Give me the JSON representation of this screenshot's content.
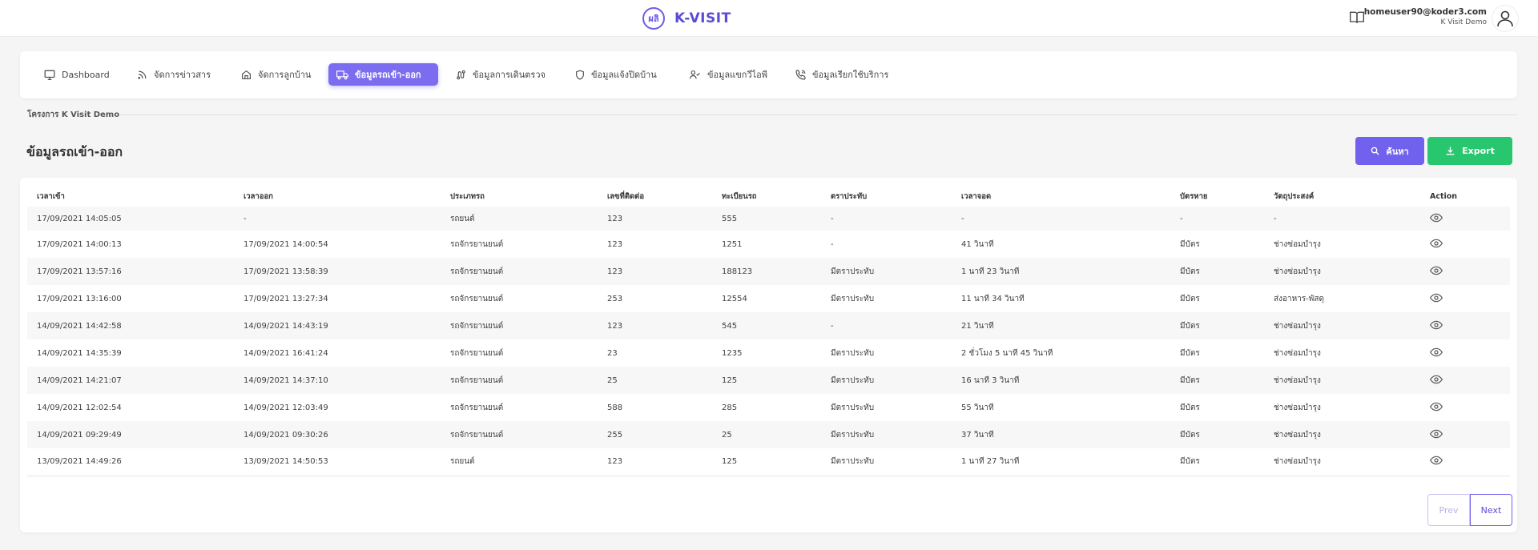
{
  "header": {
    "brand_mark": "ผลิ",
    "brand_name": "K-VISIT",
    "user_email": "homeuser90@koder3.com",
    "user_org": "K Visit Demo"
  },
  "nav": {
    "items": [
      {
        "label": "Dashboard",
        "icon": "monitor-icon"
      },
      {
        "label": "จัดการข่าวสาร",
        "icon": "rss-icon"
      },
      {
        "label": "จัดการลูกบ้าน",
        "icon": "home-icon"
      },
      {
        "label": "ข้อมูลรถเข้า-ออก",
        "icon": "truck-icon",
        "active": true
      },
      {
        "label": "ข้อมูลการเดินตรวจ",
        "icon": "route-icon"
      },
      {
        "label": "ข้อมูลแจ้งปิดบ้าน",
        "icon": "shield-icon"
      },
      {
        "label": "ข้อมูลแขกวีไอพี",
        "icon": "user-check-icon"
      },
      {
        "label": "ข้อมูลเรียกใช้บริการ",
        "icon": "phone-call-icon"
      }
    ]
  },
  "section_label": "โครงการ K Visit Demo",
  "page_title": "ข้อมูลรถเข้า-ออก",
  "buttons": {
    "search": "ค้นหา",
    "export": "Export"
  },
  "table": {
    "headers": [
      "เวลาเข้า",
      "เวลาออก",
      "ประเภทรถ",
      "เลขที่ติดต่อ",
      "ทะเบียนรถ",
      "ตราประทับ",
      "เวลาจอด",
      "บัตรหาย",
      "วัตถุประสงค์",
      "Action"
    ],
    "rows": [
      [
        "17/09/2021 14:05:05",
        "-",
        "รถยนต์",
        "123",
        "555",
        "-",
        "-",
        "-",
        "-"
      ],
      [
        "17/09/2021 14:00:13",
        "17/09/2021 14:00:54",
        "รถจักรยานยนต์",
        "123",
        "1251",
        "-",
        "41 วินาที",
        "มีบัตร",
        "ช่างซ่อมบำรุง"
      ],
      [
        "17/09/2021 13:57:16",
        "17/09/2021 13:58:39",
        "รถจักรยานยนต์",
        "123",
        "188123",
        "มีตราประทับ",
        "1 นาที 23 วินาที",
        "มีบัตร",
        "ช่างซ่อมบำรุง"
      ],
      [
        "17/09/2021 13:16:00",
        "17/09/2021 13:27:34",
        "รถจักรยานยนต์",
        "253",
        "12554",
        "มีตราประทับ",
        "11 นาที 34 วินาที",
        "มีบัตร",
        "ส่งอาหาร-พัสดุ"
      ],
      [
        "14/09/2021 14:42:58",
        "14/09/2021 14:43:19",
        "รถจักรยานยนต์",
        "123",
        "545",
        "-",
        "21 วินาที",
        "มีบัตร",
        "ช่างซ่อมบำรุง"
      ],
      [
        "14/09/2021 14:35:39",
        "14/09/2021 16:41:24",
        "รถจักรยานยนต์",
        "23",
        "1235",
        "มีตราประทับ",
        "2 ชั่วโมง 5 นาที 45 วินาที",
        "มีบัตร",
        "ช่างซ่อมบำรุง"
      ],
      [
        "14/09/2021 14:21:07",
        "14/09/2021 14:37:10",
        "รถจักรยานยนต์",
        "25",
        "125",
        "มีตราประทับ",
        "16 นาที 3 วินาที",
        "มีบัตร",
        "ช่างซ่อมบำรุง"
      ],
      [
        "14/09/2021 12:02:54",
        "14/09/2021 12:03:49",
        "รถจักรยานยนต์",
        "588",
        "285",
        "มีตราประทับ",
        "55 วินาที",
        "มีบัตร",
        "ช่างซ่อมบำรุง"
      ],
      [
        "14/09/2021 09:29:49",
        "14/09/2021 09:30:26",
        "รถจักรยานยนต์",
        "255",
        "25",
        "มีตราประทับ",
        "37 วินาที",
        "มีบัตร",
        "ช่างซ่อมบำรุง"
      ],
      [
        "13/09/2021 14:49:26",
        "13/09/2021 14:50:53",
        "รถยนต์",
        "123",
        "125",
        "มีตราประทับ",
        "1 นาที 27 วินาที",
        "มีบัตร",
        "ช่างซ่อมบำรุง"
      ]
    ]
  },
  "pagination": {
    "prev": "Prev",
    "next": "Next"
  },
  "colors": {
    "accent": "#7161ef",
    "export": "#28c76f"
  }
}
